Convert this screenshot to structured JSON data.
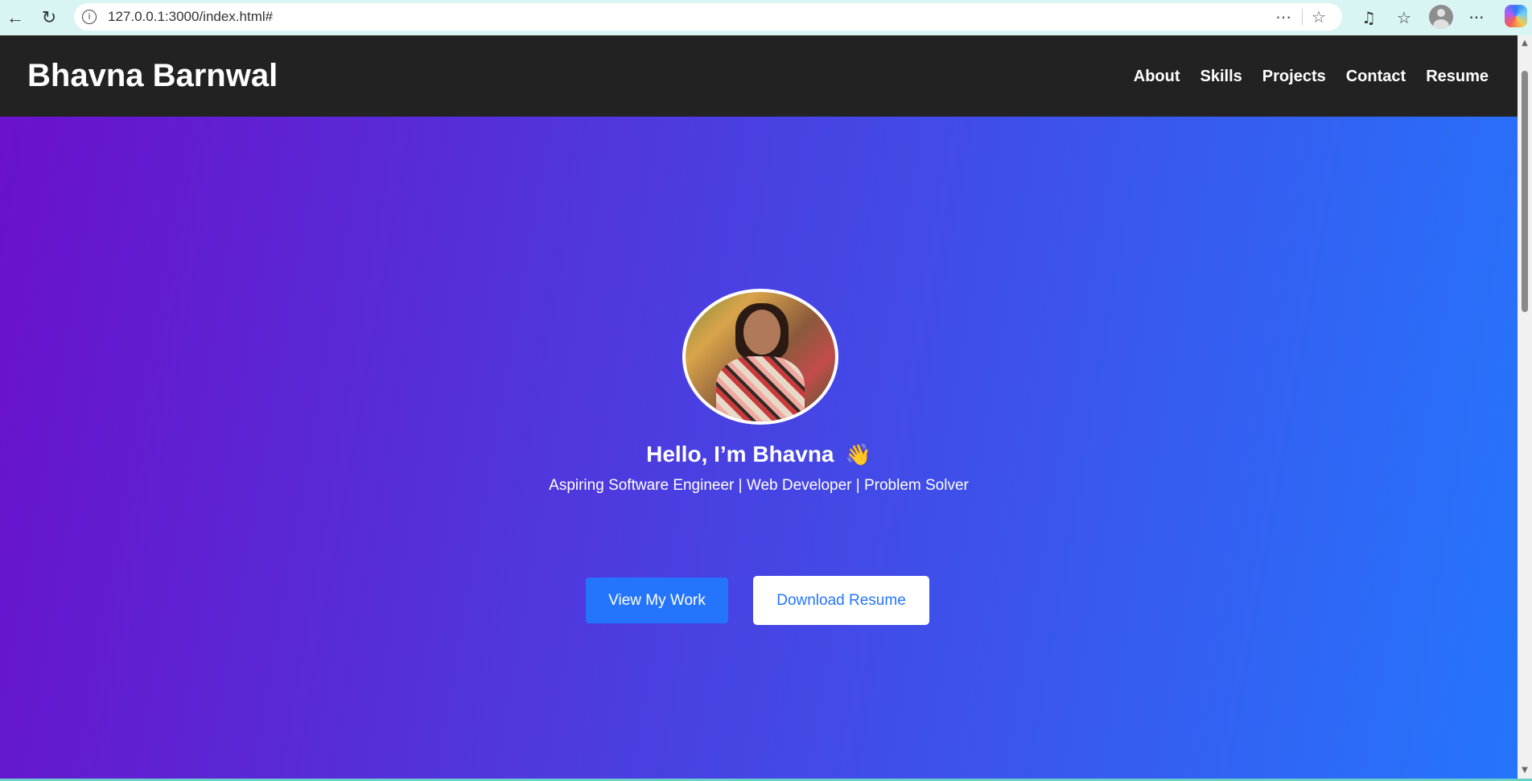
{
  "browser": {
    "url": "127.0.0.1:3000/index.html#",
    "back_icon": "←",
    "reload_icon": "↻",
    "info_icon": "i",
    "more_icon": "⋯",
    "favorite_icon": "☆",
    "media_icon": "♫",
    "favorites_icon": "☆",
    "menu_icon": "···"
  },
  "site": {
    "logo": "Bhavna Barnwal",
    "nav": [
      "About",
      "Skills",
      "Projects",
      "Contact",
      "Resume"
    ]
  },
  "hero": {
    "title": "Hello, I’m Bhavna",
    "wave": "👋",
    "subtitle": "Aspiring Software Engineer | Web Developer | Problem Solver",
    "primary_button": "View My Work",
    "secondary_button": "Download Resume"
  },
  "colors": {
    "header_bg": "#222222",
    "gradient_start": "#6a11cb",
    "gradient_end": "#2575fc",
    "button_primary": "#2575fc"
  },
  "scrollbar": {
    "up": "▲",
    "down": "▼"
  }
}
